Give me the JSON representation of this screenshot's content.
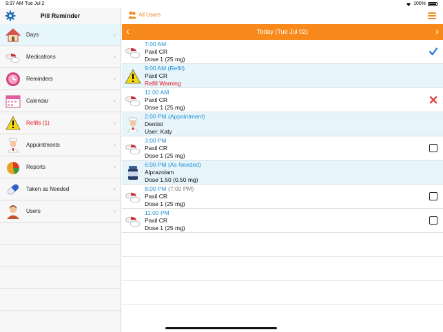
{
  "status_bar": {
    "time": "9:37 AM",
    "date": "Tue Jul 2",
    "battery": "100%"
  },
  "sidebar": {
    "title": "Pill Reminder",
    "items": [
      {
        "label": "Days",
        "icon": "house-icon",
        "selected": true
      },
      {
        "label": "Medications",
        "icon": "pills-icon"
      },
      {
        "label": "Reminders",
        "icon": "clock-icon"
      },
      {
        "label": "Calendar",
        "icon": "calendar-icon"
      },
      {
        "label": "Refills (1)",
        "icon": "warning-icon",
        "highlight": "#e0131a"
      },
      {
        "label": "Appointments",
        "icon": "nurse-icon"
      },
      {
        "label": "Reports",
        "icon": "pie-chart-icon"
      },
      {
        "label": "Taken as Needed",
        "icon": "capsule-icon"
      },
      {
        "label": "Users",
        "icon": "user-icon"
      }
    ]
  },
  "main": {
    "users_label": "All Users",
    "day_label": "Today (Tue Jul 02)",
    "accent": "#f88a1b",
    "events": [
      {
        "time": "7:00 AM",
        "name": "Paxil CR",
        "detail": "Dose 1 (25 mg)",
        "icon": "pills-icon",
        "status": "taken"
      },
      {
        "time": "9:00 AM (Refill)",
        "name": "Paxil CR",
        "detail": "Refill Warning",
        "icon": "warning-icon",
        "status": "none"
      },
      {
        "time": "11:00 AM",
        "name": "Paxil CR",
        "detail": "Dose 1 (25 mg)",
        "icon": "pills-icon",
        "status": "skipped"
      },
      {
        "time": "2:00 PM (Appointment)",
        "name": "Dentist",
        "detail": "User: Katy",
        "icon": "nurse-icon",
        "status": "none"
      },
      {
        "time": "3:00 PM",
        "name": "Paxil CR",
        "detail": "Dose 1 (25 mg)",
        "icon": "pills-icon",
        "status": "unchecked"
      },
      {
        "time": "6:00 PM (As Needed)",
        "name": "Alprazolam",
        "detail": "Dose 1.50 (0.50 mg)",
        "icon": "bottle-icon",
        "status": "none"
      },
      {
        "time": "8:00 PM",
        "time_extra": "(7:00 PM)",
        "name": "Paxil CR",
        "detail": "Dose 1 (25 mg)",
        "icon": "pills-icon",
        "status": "unchecked"
      },
      {
        "time": "11:00 PM",
        "name": "Paxil CR",
        "detail": "Dose 1 (25 mg)",
        "icon": "pills-icon",
        "status": "unchecked"
      }
    ]
  }
}
